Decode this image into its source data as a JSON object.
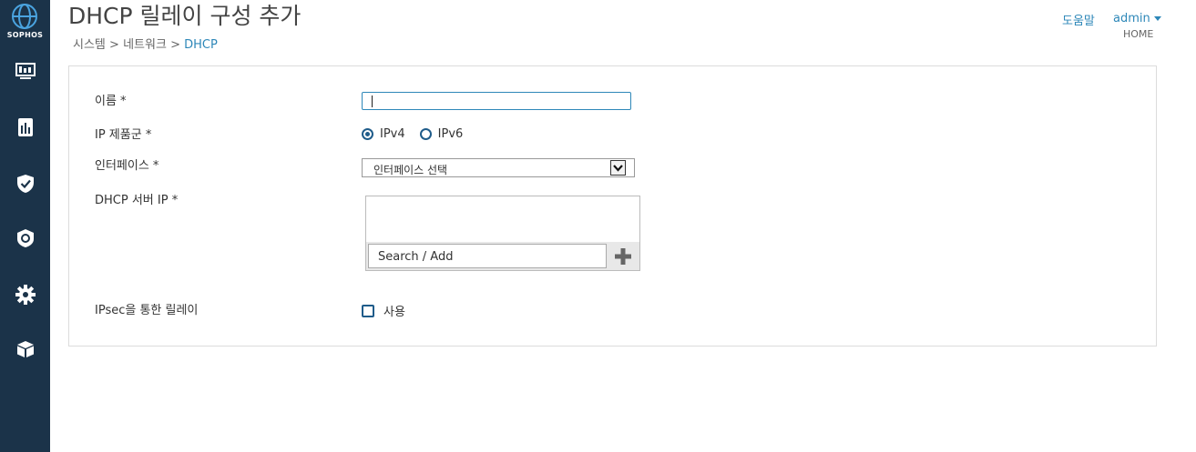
{
  "sidebar": {
    "brand": "SOPHOS",
    "items": [
      {
        "icon": "monitor-icon"
      },
      {
        "icon": "report-icon"
      },
      {
        "icon": "shield-check-icon"
      },
      {
        "icon": "security-badge-icon"
      },
      {
        "icon": "gear-icon"
      },
      {
        "icon": "cube-icon"
      }
    ]
  },
  "header": {
    "title": "DHCP 릴레이 구성 추가",
    "breadcrumb": [
      "시스템",
      "네트워크",
      "DHCP"
    ],
    "breadcrumb_separator": ">",
    "help": "도움말",
    "user": "admin",
    "home": "HOME"
  },
  "form": {
    "name_label": "이름 *",
    "name_value": "",
    "ip_family_label": "IP 제품군 *",
    "ip_family_options": [
      "IPv4",
      "IPv6"
    ],
    "ip_family_selected": "IPv4",
    "interface_label": "인터페이스 *",
    "interface_selected": "인터페이스 선택",
    "dhcp_server_label": "DHCP 서버 IP *",
    "search_placeholder": "Search / Add",
    "ipsec_label": "IPsec을 통한 릴레이",
    "ipsec_checkbox_label": "사용",
    "ipsec_checked": false
  },
  "colors": {
    "sidebar_bg": "#1b3349",
    "accent": "#2d87b8",
    "radio": "#1f5c8a"
  }
}
